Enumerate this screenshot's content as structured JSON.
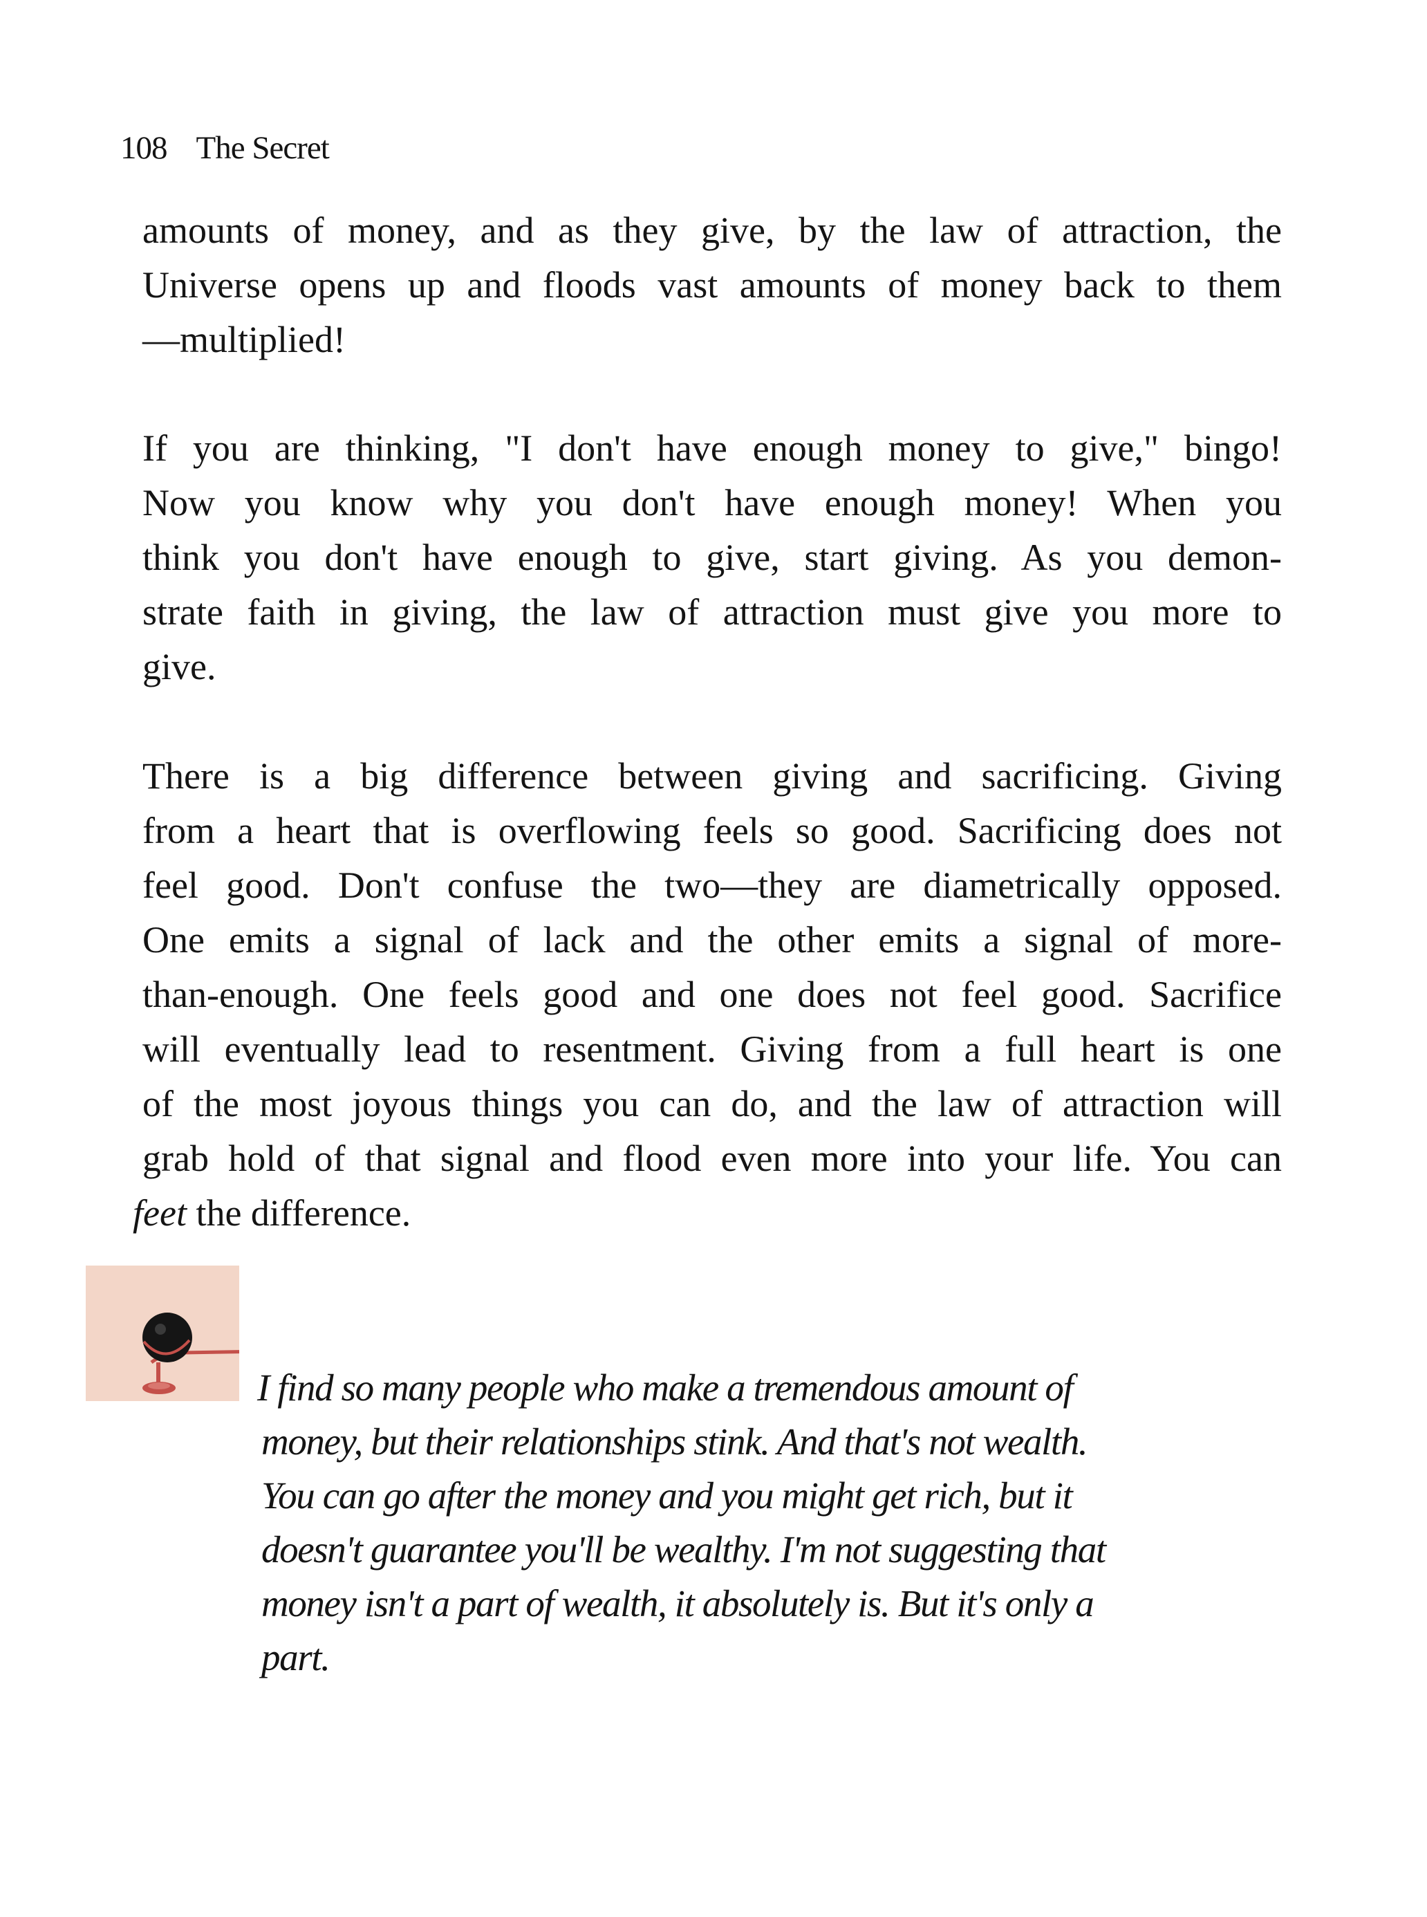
{
  "header": {
    "page_number": "108",
    "book_title": "The Secret"
  },
  "paragraph1": {
    "lines": [
      "amounts of money, and as they give, by the law of attraction, the",
      "Universe opens up and floods vast amounts of money back to them",
      "—multiplied!"
    ]
  },
  "paragraph2": {
    "lines": [
      "If you are thinking, \"I don't have enough money to give,\" bingo!",
      "Now you know why you don't have enough money! When you",
      "think you don't have enough to give, start giving. As you demon-",
      "strate faith in giving, the law of attraction must give you more to",
      "give."
    ]
  },
  "paragraph3": {
    "lines": [
      "There is a big difference between giving and sacrificing. Giving",
      "from a heart that is overflowing feels so good. Sacrificing does not",
      "feel good. Don't confuse the two—they are diametrically opposed.",
      "One emits a signal of lack and the other emits a signal of more-",
      "than-enough. One feels good and one does not feel good. Sacrifice",
      "will eventually lead to resentment. Giving from a full heart is one",
      "of the most joyous things you can do, and the law of attraction will",
      "grab hold of that signal and flood even more into your life. You can"
    ],
    "last_line_emphasis": "feet",
    "last_line_rest": " the difference."
  },
  "quote": {
    "icon": "globe-icon",
    "colors": {
      "icon_background": "#f3d6c8",
      "globe": "#151515",
      "stand": "#c4504a"
    },
    "lines": [
      "I find so many people who make a tremendous amount of",
      "money, but their relationships stink. And that's not wealth.",
      "You can go after the money and you might get rich, but it",
      "doesn't guarantee you'll be wealthy. I'm not suggesting that",
      "money isn't a part of wealth, it absolutely is. But it's only a",
      "part."
    ]
  }
}
